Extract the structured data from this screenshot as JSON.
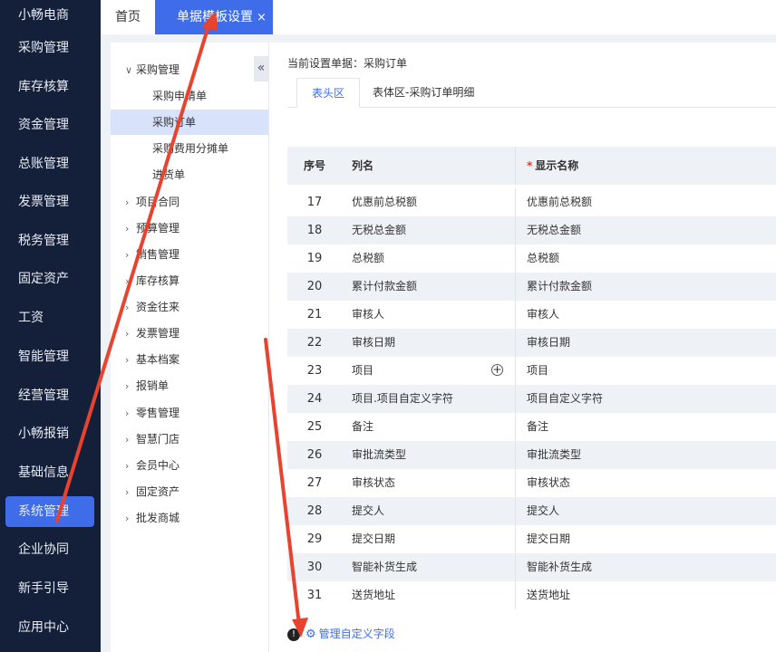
{
  "sidebar": {
    "items": [
      {
        "label": "小畅电商"
      },
      {
        "label": "采购管理"
      },
      {
        "label": "库存核算"
      },
      {
        "label": "资金管理"
      },
      {
        "label": "总账管理"
      },
      {
        "label": "发票管理"
      },
      {
        "label": "税务管理"
      },
      {
        "label": "固定资产"
      },
      {
        "label": "工资"
      },
      {
        "label": "智能管理"
      },
      {
        "label": "经营管理"
      },
      {
        "label": "小畅报销"
      },
      {
        "label": "基础信息"
      },
      {
        "label": "系统管理",
        "active": true
      },
      {
        "label": "企业协同"
      },
      {
        "label": "新手引导"
      },
      {
        "label": "应用中心"
      }
    ]
  },
  "top_tabs": {
    "home": "首页",
    "active": "单据模板设置",
    "close_glyph": "×"
  },
  "tree": {
    "collapse_glyph": "«",
    "nodes": [
      {
        "label": "采购管理",
        "level": 1,
        "expanded": true
      },
      {
        "label": "采购申请单",
        "level": 2
      },
      {
        "label": "采购订单",
        "level": 2,
        "selected": true
      },
      {
        "label": "采购费用分摊单",
        "level": 2
      },
      {
        "label": "进货单",
        "level": 2
      },
      {
        "label": "项目合同",
        "level": 1
      },
      {
        "label": "预算管理",
        "level": 1
      },
      {
        "label": "销售管理",
        "level": 1
      },
      {
        "label": "库存核算",
        "level": 1
      },
      {
        "label": "资金往来",
        "level": 1
      },
      {
        "label": "发票管理",
        "level": 1
      },
      {
        "label": "基本档案",
        "level": 1
      },
      {
        "label": "报销单",
        "level": 1
      },
      {
        "label": "零售管理",
        "level": 1
      },
      {
        "label": "智慧门店",
        "level": 1
      },
      {
        "label": "会员中心",
        "level": 1
      },
      {
        "label": "固定资产",
        "level": 1
      },
      {
        "label": "批发商城",
        "level": 1
      }
    ]
  },
  "main": {
    "current_doc": "当前设置单据：采购订单",
    "sub_tabs": [
      "表头区",
      "表体区-采购订单明细"
    ],
    "table": {
      "headers": {
        "seq": "序号",
        "name": "列名",
        "display": "显示名称",
        "required_mark": "*"
      },
      "rows": [
        {
          "seq": "17",
          "name": "优惠前总税额",
          "display": "优惠前总税额"
        },
        {
          "seq": "18",
          "name": "无税总金额",
          "display": "无税总金额"
        },
        {
          "seq": "19",
          "name": "总税额",
          "display": "总税额"
        },
        {
          "seq": "20",
          "name": "累计付款金额",
          "display": "累计付款金额"
        },
        {
          "seq": "21",
          "name": "审核人",
          "display": "审核人"
        },
        {
          "seq": "22",
          "name": "审核日期",
          "display": "审核日期"
        },
        {
          "seq": "23",
          "name": "项目",
          "display": "项目",
          "has_plus": true
        },
        {
          "seq": "24",
          "name": "项目.项目自定义字符",
          "display": "项目自定义字符"
        },
        {
          "seq": "25",
          "name": "备注",
          "display": "备注"
        },
        {
          "seq": "26",
          "name": "审批流类型",
          "display": "审批流类型"
        },
        {
          "seq": "27",
          "name": "审核状态",
          "display": "审核状态"
        },
        {
          "seq": "28",
          "name": "提交人",
          "display": "提交人"
        },
        {
          "seq": "29",
          "name": "提交日期",
          "display": "提交日期"
        },
        {
          "seq": "30",
          "name": "智能补货生成",
          "display": "智能补货生成"
        },
        {
          "seq": "31",
          "name": "送货地址",
          "display": "送货地址"
        }
      ]
    },
    "footer": {
      "info_glyph": "!",
      "gear_glyph": "⚙",
      "manage_label": "管理自定义字段"
    }
  },
  "colors": {
    "sidebar_bg": "#14203a",
    "accent": "#3f6ce8",
    "annotation_arrow": "#e8432f"
  }
}
